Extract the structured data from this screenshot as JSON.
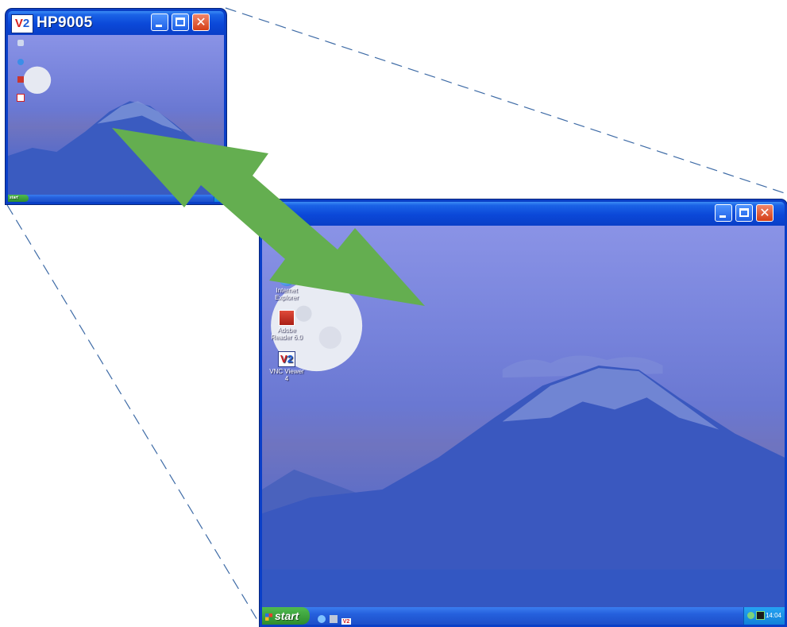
{
  "small_window": {
    "title": "HP9005",
    "app_logo": "vnc-logo",
    "controls": [
      "minimize-icon",
      "maximize-icon",
      "close-icon"
    ],
    "taskbar": {
      "start_label": "start"
    }
  },
  "big_window": {
    "controls": [
      "minimize-icon",
      "maximize-icon",
      "close-icon"
    ],
    "desktop_icons": [
      {
        "label": "Internet Explorer",
        "icon": "internet-explorer-icon"
      },
      {
        "label": "Adobe Reader 6.0",
        "icon": "adobe-reader-icon"
      },
      {
        "label": "VNC Viewer 4",
        "icon": "vnc-viewer-icon"
      }
    ],
    "taskbar": {
      "start_label": "start",
      "clock": "14:04"
    }
  },
  "arrow": {
    "color": "#64ae50",
    "meaning": "double-headed-arrow"
  },
  "colors": {
    "xp_blue": "#0a3fc7",
    "start_green": "#3a9d3a",
    "close_red": "#d43e17"
  }
}
